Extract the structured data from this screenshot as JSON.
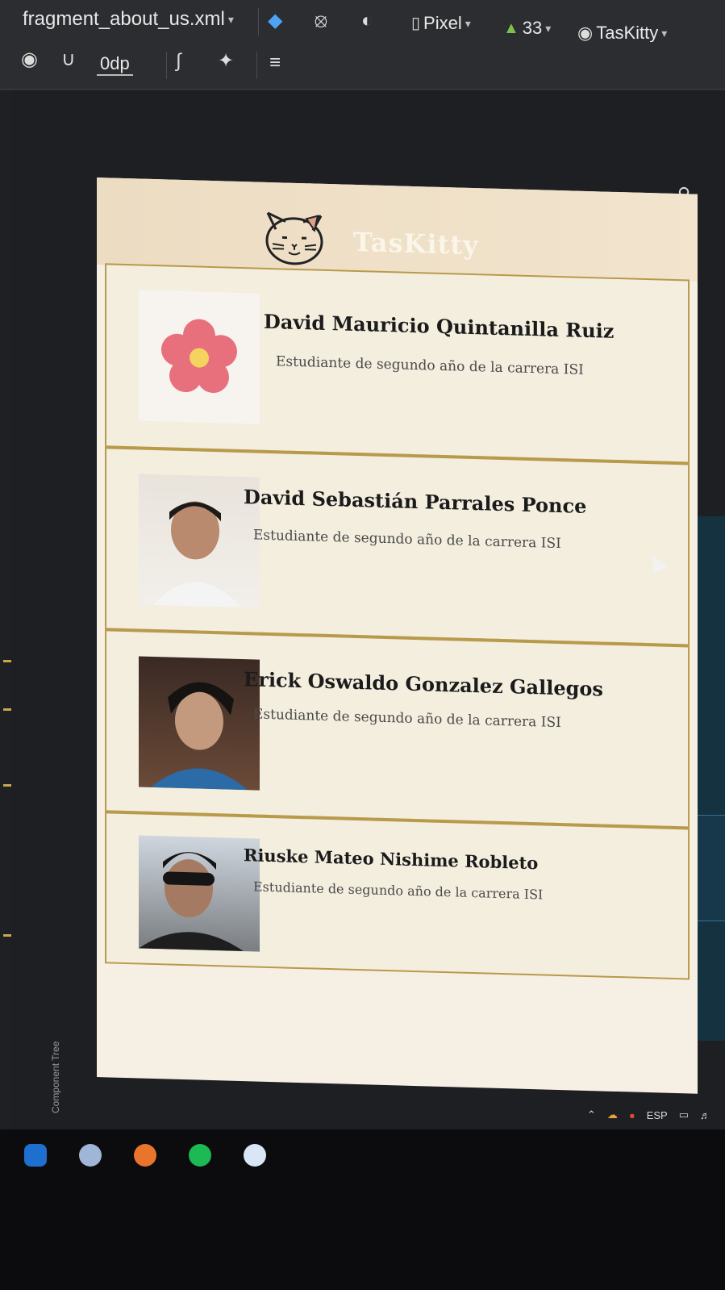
{
  "ide": {
    "file_tab": "fragment_about_us.xml",
    "device": "Pixel",
    "api_level": "33",
    "theme": "TasKitty",
    "margin_value": "0dp",
    "component_tree_label": "Component Tree"
  },
  "app": {
    "title": "TasKitty",
    "colors": {
      "appbar": "#ecdcc2",
      "card_border": "#b89a4b",
      "card_bg": "#f4eedf"
    }
  },
  "members": [
    {
      "name": "David Mauricio Quintanilla Ruiz",
      "role": "Estudiante de segundo año de la carrera ISI",
      "avatar": "flower-avatar"
    },
    {
      "name": "David Sebastián Parrales Ponce",
      "role": "Estudiante de segundo año de la carrera ISI",
      "avatar": "photo-avatar"
    },
    {
      "name": "Erick Oswaldo Gonzalez Gallegos",
      "role": "Estudiante de segundo año de la carrera ISI",
      "avatar": "photo-avatar"
    },
    {
      "name": "Riuske Mateo Nishime Robleto",
      "role": "Estudiante de segundo año de la carrera ISI",
      "avatar": "photo-avatar"
    }
  ],
  "tray": {
    "language": "ESP"
  }
}
